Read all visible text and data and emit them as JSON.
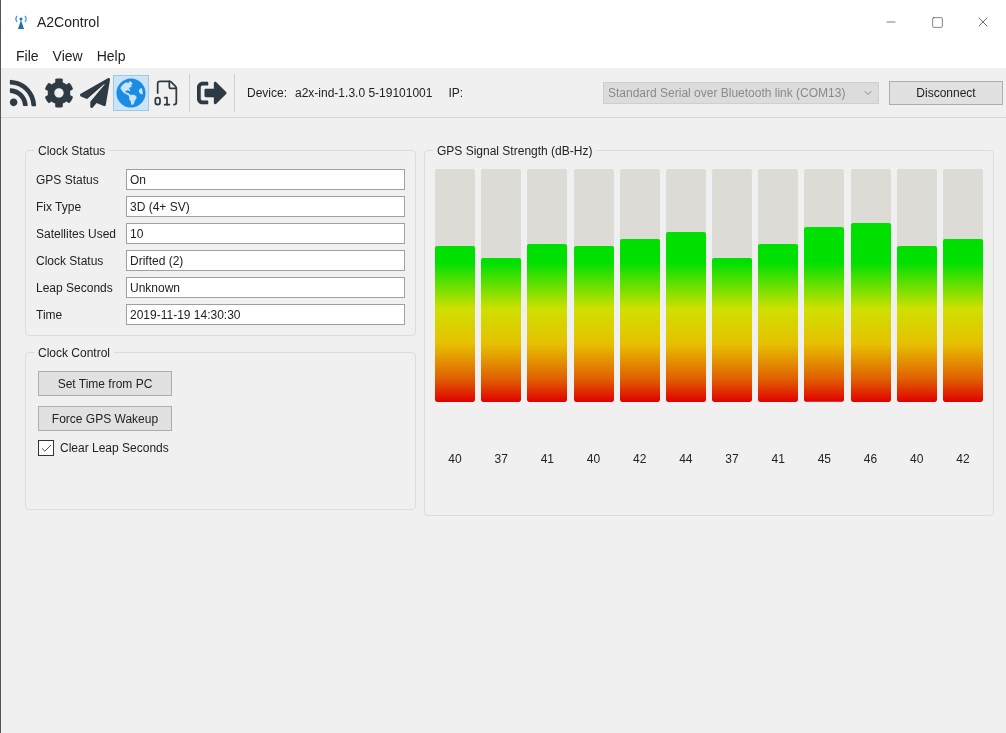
{
  "window": {
    "title": "A2Control"
  },
  "menu": [
    "File",
    "View",
    "Help"
  ],
  "toolbar": [
    {
      "kind": "rss",
      "selected": false
    },
    {
      "kind": "gear",
      "selected": false
    },
    {
      "kind": "plane",
      "selected": false
    },
    {
      "kind": "globe",
      "selected": true
    },
    {
      "kind": "binary",
      "selected": false
    },
    {
      "kind": "exit",
      "selected": false
    }
  ],
  "device": {
    "label": "Device:",
    "value": "a2x-ind-1.3.0 5-19101001",
    "ip_label": "IP:"
  },
  "port_select": {
    "value": "Standard Serial over Bluetooth link (COM13)",
    "disabled": true
  },
  "disconnect_button": "Disconnect",
  "clock_status": {
    "title": "Clock Status",
    "fields": [
      {
        "label": "GPS Status",
        "value": "On"
      },
      {
        "label": "Fix Type",
        "value": "3D (4+ SV)"
      },
      {
        "label": "Satellites Used",
        "value": "10"
      },
      {
        "label": "Clock Status",
        "value": "Drifted (2)"
      },
      {
        "label": "Leap Seconds",
        "value": "Unknown"
      },
      {
        "label": "Time",
        "value": "2019-11-19 14:30:30"
      }
    ]
  },
  "clock_control": {
    "title": "Clock Control",
    "buttons": [
      "Set Time from PC",
      "Force GPS Wakeup"
    ],
    "checkbox": {
      "label": "Clear Leap Seconds",
      "checked": true
    }
  },
  "signal": {
    "title": "GPS Signal Strength (dB-Hz)",
    "bars": [
      {
        "level": 0.67,
        "reading": "40"
      },
      {
        "level": 0.62,
        "reading": "37"
      },
      {
        "level": 0.68,
        "reading": "41"
      },
      {
        "level": 0.67,
        "reading": "40"
      },
      {
        "level": 0.7,
        "reading": "42"
      },
      {
        "level": 0.73,
        "reading": "44"
      },
      {
        "level": 0.62,
        "reading": "37"
      },
      {
        "level": 0.68,
        "reading": "41"
      },
      {
        "level": 0.75,
        "reading": "45"
      },
      {
        "level": 0.77,
        "reading": "46"
      },
      {
        "level": 0.67,
        "reading": "40"
      },
      {
        "level": 0.7,
        "reading": "42"
      }
    ]
  }
}
